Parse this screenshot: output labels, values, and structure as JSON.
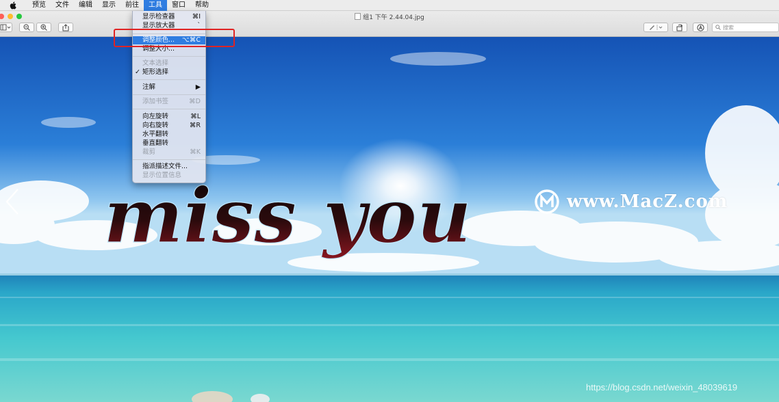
{
  "menubar": {
    "items": [
      "预览",
      "文件",
      "编辑",
      "显示",
      "前往",
      "工具",
      "窗口",
      "帮助"
    ],
    "active_index": 5
  },
  "window": {
    "title": "组1 下午 2.44.04.jpg"
  },
  "toolbar": {
    "search_placeholder": "搜索",
    "icons": [
      "sidebar-icon",
      "zoom-out-icon",
      "zoom-in-icon",
      "share-icon",
      "markup-pen-icon",
      "rotate-icon",
      "annotate-icon"
    ]
  },
  "tools_menu": {
    "items": [
      {
        "label": "显示检查器",
        "shortcut": "⌘I",
        "enabled": true
      },
      {
        "label": "显示放大器",
        "shortcut": "`",
        "enabled": true
      },
      {
        "label": "调整颜色...",
        "shortcut": "⌥⌘C",
        "enabled": true,
        "highlighted": true
      },
      {
        "label": "调整大小...",
        "shortcut": "",
        "enabled": true
      },
      {
        "label": "文本选择",
        "shortcut": "",
        "enabled": false
      },
      {
        "label": "矩形选择",
        "shortcut": "",
        "enabled": true,
        "checked": true
      },
      {
        "label": "注解",
        "shortcut": "▶",
        "enabled": true
      },
      {
        "label": "添加书签",
        "shortcut": "⌘D",
        "enabled": false
      },
      {
        "label": "向左旋转",
        "shortcut": "⌘L",
        "enabled": true
      },
      {
        "label": "向右旋转",
        "shortcut": "⌘R",
        "enabled": true
      },
      {
        "label": "水平翻转",
        "shortcut": "",
        "enabled": true
      },
      {
        "label": "垂直翻转",
        "shortcut": "",
        "enabled": true
      },
      {
        "label": "裁剪",
        "shortcut": "⌘K",
        "enabled": false
      },
      {
        "label": "指派描述文件...",
        "shortcut": "",
        "enabled": true
      },
      {
        "label": "显示位置信息",
        "shortcut": "",
        "enabled": false
      }
    ]
  },
  "image": {
    "text": "miss you",
    "watermark": "www.MacZ.com",
    "source_url": "https://blog.csdn.net/weixin_48039619"
  },
  "colors": {
    "accent": "#2f7de1",
    "highlight_box": "#e02323",
    "sky_top": "#1a5fbf",
    "sea": "#3cc6cf"
  }
}
